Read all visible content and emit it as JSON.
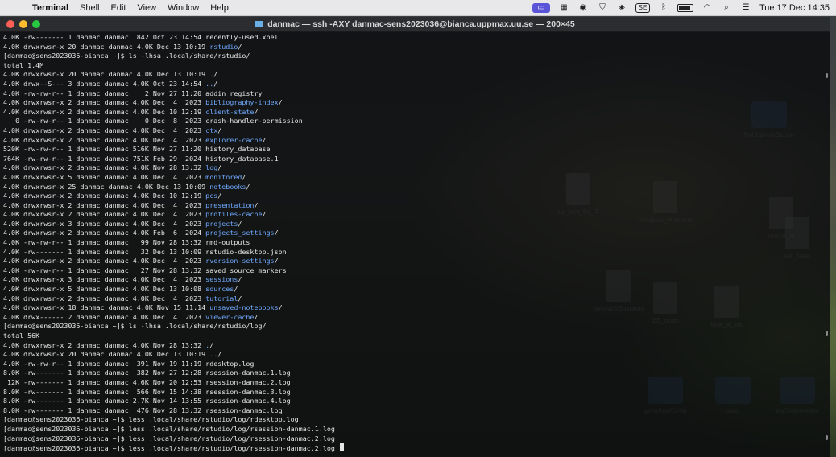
{
  "menubar": {
    "apple": "",
    "items": [
      "Terminal",
      "Shell",
      "Edit",
      "View",
      "Window",
      "Help"
    ],
    "status_icons": [
      "screen-share-icon",
      "grid-icon",
      "record-icon",
      "shield-icon",
      "vpn-icon",
      "keyboard-icon",
      "bluetooth-icon",
      "battery-icon",
      "wifi-icon",
      "search-icon",
      "control-center-icon"
    ],
    "keyboard_label": "SE",
    "clock": "Tue 17 Dec  14:35"
  },
  "window": {
    "title": "danmac — ssh -AXY danmac-sens2023036@bianca.uppmax.uu.se — 200×45"
  },
  "terminal": {
    "lines": [
      [
        {
          "t": "4.0K -rw------- 1 danmac danmac  842 Oct 23 14:54 recently-used.xbel"
        }
      ],
      [
        {
          "t": "4.0K drwxrwsr-x 20 danmac danmac 4.0K Dec 13 10:19 "
        },
        {
          "t": "rstudio",
          "c": "dir"
        },
        {
          "t": "/"
        }
      ],
      [
        {
          "t": "[danmac@sens2023036-bianca ~]$ ls -lhsa .local/share/rstudio/"
        }
      ],
      [
        {
          "t": "total 1.4M"
        }
      ],
      [
        {
          "t": "4.0K drwxrwsr-x 20 danmac danmac 4.0K Dec 13 10:19 "
        },
        {
          "t": ".",
          "c": "dir"
        },
        {
          "t": "/"
        }
      ],
      [
        {
          "t": "4.0K drwx--S--- 3 danmac danmac 4.0K Oct 23 14:54 "
        },
        {
          "t": "..",
          "c": "dir"
        },
        {
          "t": "/"
        }
      ],
      [
        {
          "t": "4.0K -rw-rw-r-- 1 danmac danmac    2 Nov 27 11:20 addin_registry"
        }
      ],
      [
        {
          "t": "4.0K drwxrwsr-x 2 danmac danmac 4.0K Dec  4  2023 "
        },
        {
          "t": "bibliography-index",
          "c": "dir"
        },
        {
          "t": "/"
        }
      ],
      [
        {
          "t": "4.0K drwxrwsr-x 2 danmac danmac 4.0K Dec 10 12:19 "
        },
        {
          "t": "client-state",
          "c": "dir"
        },
        {
          "t": "/"
        }
      ],
      [
        {
          "t": "   0 -rw-rw-r-- 1 danmac danmac    0 Dec  8  2023 crash-handler-permission"
        }
      ],
      [
        {
          "t": "4.0K drwxrwsr-x 2 danmac danmac 4.0K Dec  4  2023 "
        },
        {
          "t": "ctx",
          "c": "dir"
        },
        {
          "t": "/"
        }
      ],
      [
        {
          "t": "4.0K drwxrwsr-x 2 danmac danmac 4.0K Dec  4  2023 "
        },
        {
          "t": "explorer-cache",
          "c": "dir"
        },
        {
          "t": "/"
        }
      ],
      [
        {
          "t": "520K -rw-rw-r-- 1 danmac danmac 516K Nov 27 11:20 history_database"
        }
      ],
      [
        {
          "t": "764K -rw-rw-r-- 1 danmac danmac 751K Feb 29  2024 history_database.1"
        }
      ],
      [
        {
          "t": "4.0K drwxrwsr-x 2 danmac danmac 4.0K Nov 28 13:32 "
        },
        {
          "t": "log",
          "c": "dir"
        },
        {
          "t": "/"
        }
      ],
      [
        {
          "t": "4.0K drwxrwsr-x 5 danmac danmac 4.0K Dec  4  2023 "
        },
        {
          "t": "monitored",
          "c": "dir"
        },
        {
          "t": "/"
        }
      ],
      [
        {
          "t": "4.0K drwxrwsr-x 25 danmac danmac 4.0K Dec 13 10:09 "
        },
        {
          "t": "notebooks",
          "c": "dir"
        },
        {
          "t": "/"
        }
      ],
      [
        {
          "t": "4.0K drwxrwsr-x 2 danmac danmac 4.0K Dec 10 12:19 "
        },
        {
          "t": "pcs",
          "c": "dir"
        },
        {
          "t": "/"
        }
      ],
      [
        {
          "t": "4.0K drwxrwsr-x 2 danmac danmac 4.0K Dec  4  2023 "
        },
        {
          "t": "presentation",
          "c": "dir"
        },
        {
          "t": "/"
        }
      ],
      [
        {
          "t": "4.0K drwxrwsr-x 2 danmac danmac 4.0K Dec  4  2023 "
        },
        {
          "t": "profiles-cache",
          "c": "dir"
        },
        {
          "t": "/"
        }
      ],
      [
        {
          "t": "4.0K drwxrwsr-x 3 danmac danmac 4.0K Dec  4  2023 "
        },
        {
          "t": "projects",
          "c": "dir"
        },
        {
          "t": "/"
        }
      ],
      [
        {
          "t": "4.0K drwxrwsr-x 2 danmac danmac 4.0K Feb  6  2024 "
        },
        {
          "t": "projects_settings",
          "c": "dir"
        },
        {
          "t": "/"
        }
      ],
      [
        {
          "t": "4.0K -rw-rw-r-- 1 danmac danmac   99 Nov 28 13:32 rmd-outputs"
        }
      ],
      [
        {
          "t": "4.0K -rw------- 1 danmac danmac   32 Dec 13 10:09 rstudio-desktop.json"
        }
      ],
      [
        {
          "t": "4.0K drwxrwsr-x 2 danmac danmac 4.0K Dec  4  2023 "
        },
        {
          "t": "rversion-settings",
          "c": "dir"
        },
        {
          "t": "/"
        }
      ],
      [
        {
          "t": "4.0K -rw-rw-r-- 1 danmac danmac   27 Nov 28 13:32 saved_source_markers"
        }
      ],
      [
        {
          "t": "4.0K drwxrwsr-x 3 danmac danmac 4.0K Dec  4  2023 "
        },
        {
          "t": "sessions",
          "c": "dir"
        },
        {
          "t": "/"
        }
      ],
      [
        {
          "t": "4.0K drwxrwsr-x 5 danmac danmac 4.0K Dec 13 10:08 "
        },
        {
          "t": "sources",
          "c": "dir"
        },
        {
          "t": "/"
        }
      ],
      [
        {
          "t": "4.0K drwxrwsr-x 2 danmac danmac 4.0K Dec  4  2023 "
        },
        {
          "t": "tutorial",
          "c": "dir"
        },
        {
          "t": "/"
        }
      ],
      [
        {
          "t": "4.0K drwxrwsr-x 18 danmac danmac 4.0K Nov 15 11:14 "
        },
        {
          "t": "unsaved-notebooks",
          "c": "dir"
        },
        {
          "t": "/"
        }
      ],
      [
        {
          "t": "4.0K drwx------ 2 danmac danmac 4.0K Dec  4  2023 "
        },
        {
          "t": "viewer-cache",
          "c": "dir"
        },
        {
          "t": "/"
        }
      ],
      [
        {
          "t": "[danmac@sens2023036-bianca ~]$ ls -lhsa .local/share/rstudio/log/"
        }
      ],
      [
        {
          "t": "total 56K"
        }
      ],
      [
        {
          "t": "4.0K drwxrwsr-x 2 danmac danmac 4.0K Nov 28 13:32 "
        },
        {
          "t": ".",
          "c": "dir"
        },
        {
          "t": "/"
        }
      ],
      [
        {
          "t": "4.0K drwxrwsr-x 20 danmac danmac 4.0K Dec 13 10:19 "
        },
        {
          "t": "..",
          "c": "dir"
        },
        {
          "t": "/"
        }
      ],
      [
        {
          "t": "4.0K -rw-rw-r-- 1 danmac danmac  391 Nov 19 11:19 rdesktop.log"
        }
      ],
      [
        {
          "t": "8.0K -rw------- 1 danmac danmac  382 Nov 27 12:28 rsession-danmac.1.log"
        }
      ],
      [
        {
          "t": " 12K -rw------- 1 danmac danmac 4.6K Nov 20 12:53 rsession-danmac.2.log"
        }
      ],
      [
        {
          "t": "8.0K -rw------- 1 danmac danmac  566 Nov 15 14:38 rsession-danmac.3.log"
        }
      ],
      [
        {
          "t": "8.0K -rw------- 1 danmac danmac 2.7K Nov 14 13:55 rsession-danmac.4.log"
        }
      ],
      [
        {
          "t": "8.0K -rw------- 1 danmac danmac  476 Nov 28 13:32 rsession-danmac.log"
        }
      ],
      [
        {
          "t": "[danmac@sens2023036-bianca ~]$ less .local/share/rstudio/log/rdesktop.log"
        }
      ],
      [
        {
          "t": "[danmac@sens2023036-bianca ~]$ less .local/share/rstudio/log/rsession-danmac.1.log"
        }
      ],
      [
        {
          "t": "[danmac@sens2023036-bianca ~]$ less .local/share/rstudio/log/rsession-danmac.2.log"
        }
      ],
      [
        {
          "t": "[danmac@sens2023036-bianca ~]$ less .local/share/rstudio/log/rsession-danmac.2.log"
        }
      ]
    ]
  },
  "desktop": {
    "icons": [
      {
        "name": "desktop-file-icon",
        "kind": "doc",
        "label": "zip_test_for_Ti"
      },
      {
        "name": "desktop-file-icon",
        "kind": "doc",
        "label": "nsnapate_machine"
      },
      {
        "name": "desktop-folder-icon",
        "kind": "folder",
        "label": "forUppmaxSuppo"
      },
      {
        "name": "desktop-file-icon",
        "kind": "doc",
        "label": "mount_is"
      },
      {
        "name": "desktop-file-icon",
        "kind": "doc",
        "label": "ssh_tests"
      },
      {
        "name": "desktop-file-icon",
        "kind": "doc",
        "label": "saveWGSparams"
      },
      {
        "name": "desktop-file-icon",
        "kind": "doc",
        "label": "EB_bugs"
      },
      {
        "name": "desktop-file-icon",
        "kind": "doc",
        "label": "look_at_eb"
      },
      {
        "name": "desktop-folder-icon",
        "kind": "folder",
        "label": "geneAnnComp"
      },
      {
        "name": "desktop-folder-icon",
        "kind": "folder",
        "label": "misc"
      },
      {
        "name": "desktop-folder-icon",
        "kind": "folder",
        "label": "mySnakemake"
      }
    ]
  }
}
